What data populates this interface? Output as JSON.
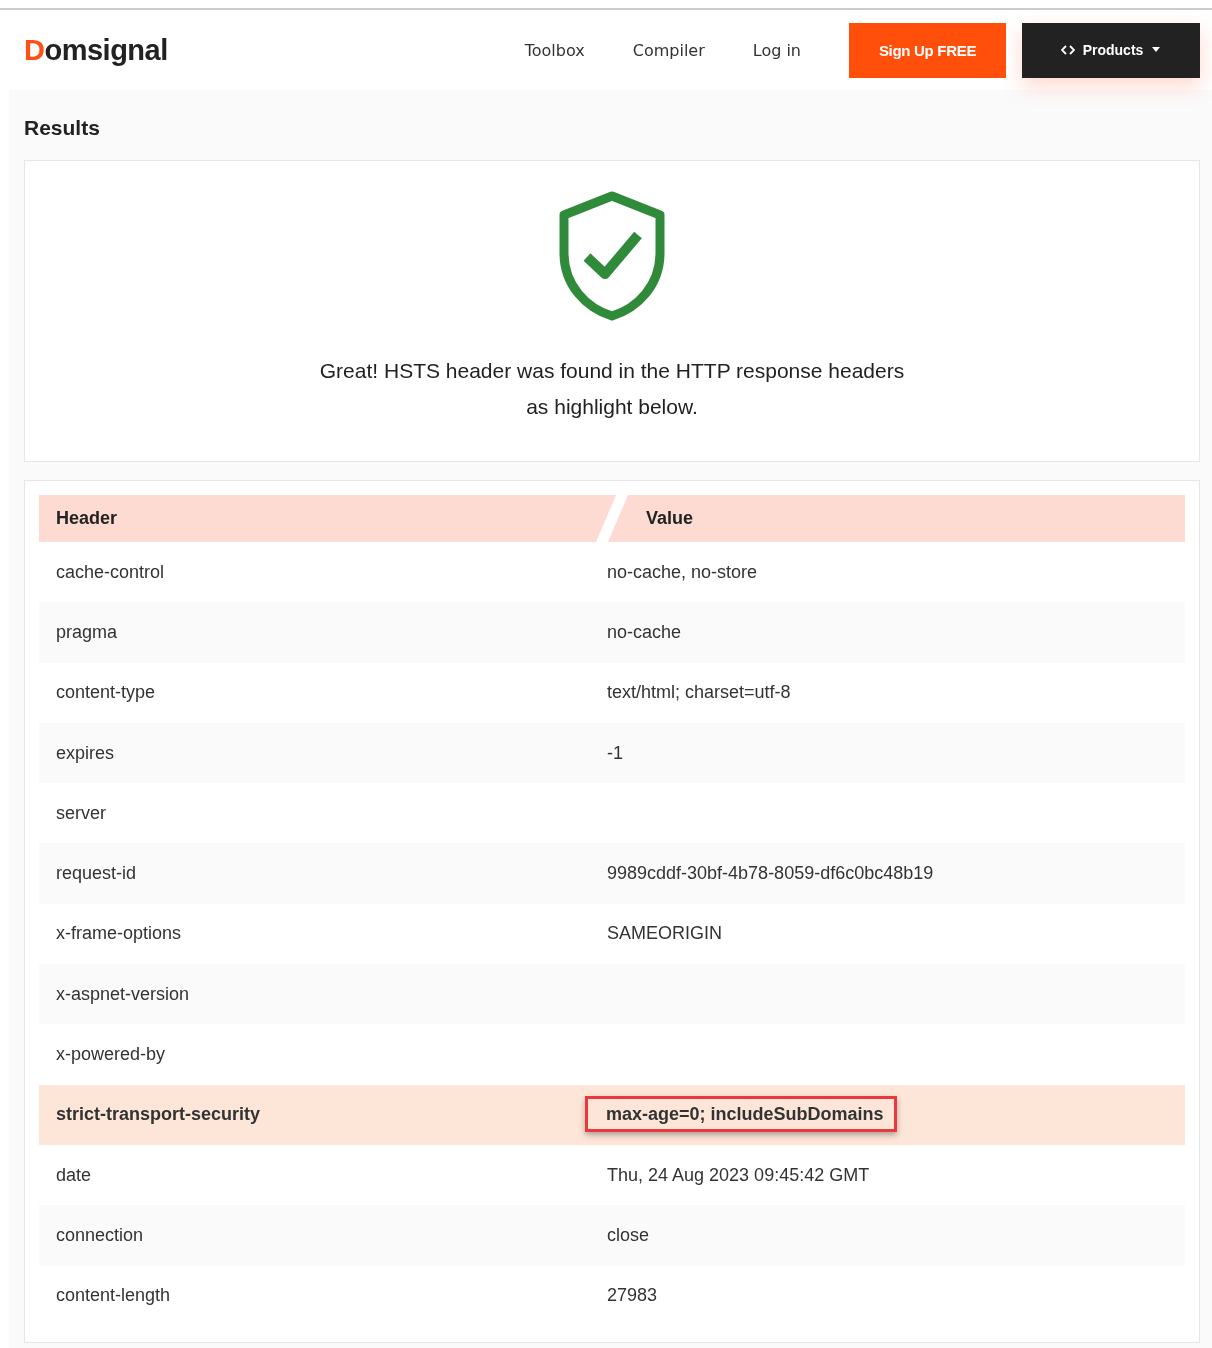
{
  "nav": {
    "logo": "Domsignal",
    "links": [
      "Toolbox",
      "Compiler",
      "Log in"
    ],
    "signup": "Sign Up FREE",
    "products": "Products"
  },
  "results": {
    "title": "Results",
    "message": "Great! HSTS header was found in the HTTP response headers as highlight below."
  },
  "table": {
    "columns": [
      "Header",
      "Value"
    ],
    "rows": [
      {
        "header": "cache-control",
        "value": "no-cache, no-store",
        "highlighted": false
      },
      {
        "header": "pragma",
        "value": "no-cache",
        "highlighted": false
      },
      {
        "header": "content-type",
        "value": "text/html; charset=utf-8",
        "highlighted": false
      },
      {
        "header": "expires",
        "value": "-1",
        "highlighted": false
      },
      {
        "header": "server",
        "value": "",
        "highlighted": false
      },
      {
        "header": "request-id",
        "value": "9989cddf-30bf-4b78-8059-df6c0bc48b19",
        "highlighted": false
      },
      {
        "header": "x-frame-options",
        "value": "SAMEORIGIN",
        "highlighted": false
      },
      {
        "header": "x-aspnet-version",
        "value": "",
        "highlighted": false
      },
      {
        "header": "x-powered-by",
        "value": "",
        "highlighted": false
      },
      {
        "header": "strict-transport-security",
        "value": "max-age=0; includeSubDomains",
        "highlighted": true
      },
      {
        "header": "date",
        "value": "Thu, 24 Aug 2023 09:45:42 GMT",
        "highlighted": false
      },
      {
        "header": "connection",
        "value": "close",
        "highlighted": false
      },
      {
        "header": "content-length",
        "value": "27983",
        "highlighted": false
      }
    ]
  }
}
